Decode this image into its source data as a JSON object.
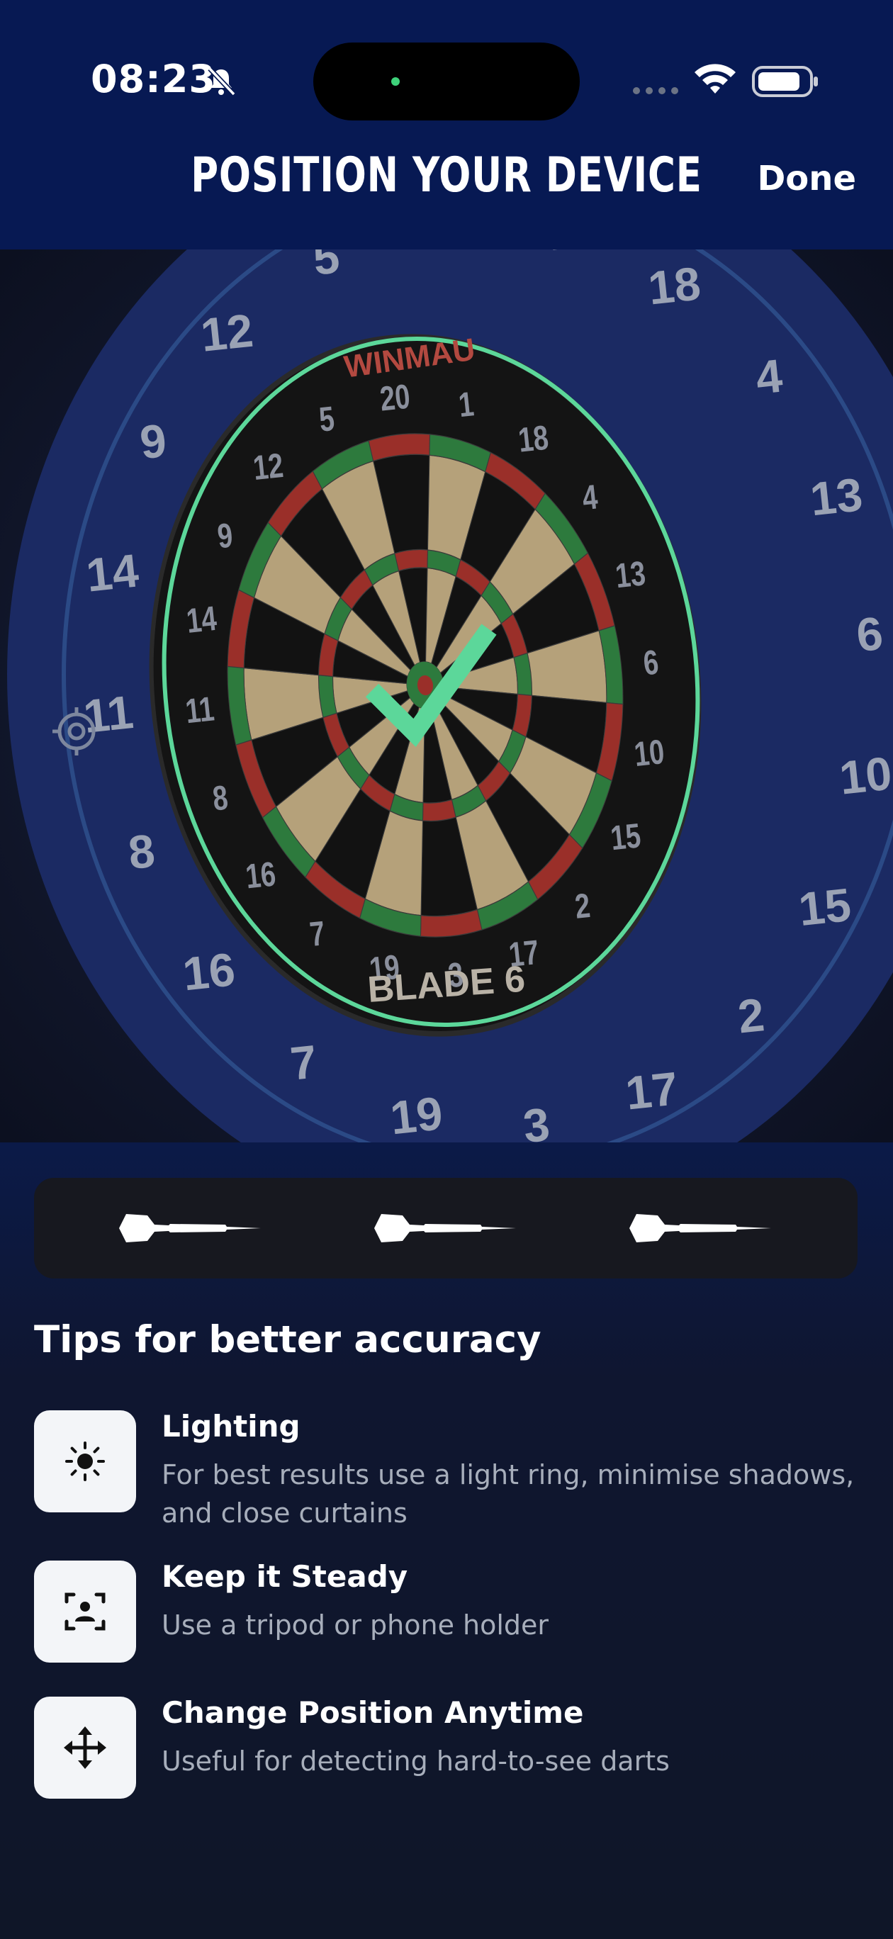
{
  "status_bar": {
    "time": "08:23",
    "icons": [
      "bell-muted-icon",
      "signal-icon",
      "wifi-icon",
      "battery-icon"
    ]
  },
  "header": {
    "title": "POSITION YOUR DEVICE",
    "done_label": "Done",
    "background": "#071953"
  },
  "camera_view": {
    "board_numbers": [
      "20",
      "1",
      "18",
      "4",
      "13",
      "6",
      "10",
      "15",
      "2",
      "17",
      "3",
      "19",
      "7",
      "16",
      "8",
      "11",
      "14",
      "9",
      "12",
      "5"
    ],
    "board_brand": "BLADE 6",
    "board_maker": "WINMAU",
    "overlay_color": "#5cd79a",
    "status_icon": "checkmark-icon"
  },
  "darts": {
    "count": 3,
    "icons": [
      "dart-icon",
      "dart-icon",
      "dart-icon"
    ]
  },
  "tips": {
    "heading": "Tips for better accuracy",
    "items": [
      {
        "icon": "sun-icon",
        "title": "Lighting",
        "description": "For best results use a light ring, minimise shadows, and close curtains"
      },
      {
        "icon": "steady-frame-icon",
        "title": "Keep it Steady",
        "description": "Use a tripod or phone holder"
      },
      {
        "icon": "move-arrows-icon",
        "title": "Change Position Anytime",
        "description": "Useful for detecting hard-to-see darts"
      }
    ]
  }
}
